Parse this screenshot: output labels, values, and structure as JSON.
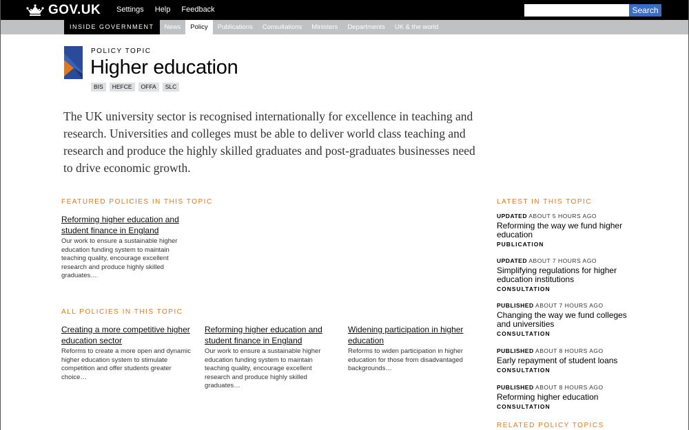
{
  "header": {
    "brand": "GOV.UK",
    "nav": [
      "Settings",
      "Help",
      "Feedback"
    ],
    "search_placeholder": "",
    "search_button": "Search"
  },
  "subnav": {
    "section": "INSIDE GOVERNMENT",
    "items": [
      {
        "label": "News",
        "active": false
      },
      {
        "label": "Policy",
        "active": true
      },
      {
        "label": "Publications",
        "active": false
      },
      {
        "label": "Consultations",
        "active": false
      },
      {
        "label": "Ministers",
        "active": false
      },
      {
        "label": "Departments",
        "active": false
      },
      {
        "label": "UK & the world",
        "active": false
      }
    ]
  },
  "topic": {
    "kicker": "POLICY TOPIC",
    "title": "Higher education",
    "orgs": [
      "BIS",
      "HEFCE",
      "OFFA",
      "SLC"
    ],
    "intro": "The UK university sector is recognised internationally for excellence in teaching and research. Universities and colleges must be able to deliver world class teaching and research and produce the highly skilled graduates and post-graduates businesses need to drive economic growth."
  },
  "featured": {
    "title": "FEATURED POLICIES IN THIS TOPIC",
    "items": [
      {
        "link": "Reforming higher education and student finance in England",
        "desc": "Our work to ensure a sustainable higher education funding system to maintain teaching quality, encourage excellent research and produce highly skilled graduates…"
      }
    ]
  },
  "all": {
    "title": "ALL POLICIES IN THIS TOPIC",
    "items": [
      {
        "link": "Creating a more competitive higher education sector",
        "desc": "Reforms to create a more open and dynamic higher education system to stimulate competition and offer students greater choice…"
      },
      {
        "link": "Reforming higher education and student finance in England",
        "desc": "Our work to ensure a sustainable higher education funding system to maintain teaching quality, encourage excellent research and produce highly skilled graduates…"
      },
      {
        "link": "Widening participation in higher education",
        "desc": "Reforms to widen participation in higher education for those from disadvantaged backgrounds…"
      }
    ]
  },
  "latest": {
    "title": "LATEST IN THIS TOPIC",
    "items": [
      {
        "status": "UPDATED",
        "when": "ABOUT 5 HOURS AGO",
        "link": "Reforming the way we fund higher education",
        "type": "PUBLICATION"
      },
      {
        "status": "UPDATED",
        "when": "ABOUT 7 HOURS AGO",
        "link": "Simplifying regulations for higher education institutions",
        "type": "CONSULTATION"
      },
      {
        "status": "PUBLISHED",
        "when": "ABOUT 7 HOURS AGO",
        "link": "Changing the way we fund colleges and universities",
        "type": "CONSULTATION"
      },
      {
        "status": "PUBLISHED",
        "when": "ABOUT 8 HOURS AGO",
        "link": "Early repayment of student loans",
        "type": "CONSULTATION"
      },
      {
        "status": "PUBLISHED",
        "when": "ABOUT 8 HOURS AGO",
        "link": "Reforming higher education",
        "type": "CONSULTATION"
      }
    ]
  },
  "related": {
    "title": "RELATED POLICY TOPICS"
  },
  "colors": {
    "accent": "#e2781b",
    "topbar": "#000000",
    "subnav": "#bfc1c3",
    "search_button": "#3b6ec2",
    "ribbon_blue": "#2a4a9a",
    "ribbon_orange": "#e2781b"
  },
  "icons": {
    "brand": "crown-icon",
    "topic": "bookmark-ribbon-icon"
  }
}
